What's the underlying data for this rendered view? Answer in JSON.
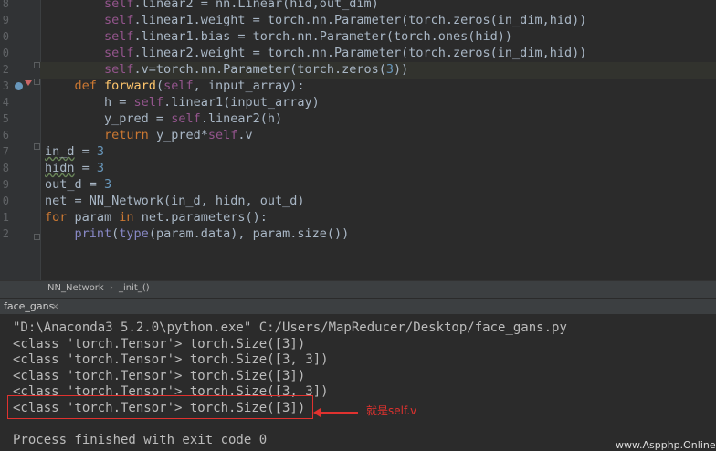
{
  "editor": {
    "line_numbers": [
      "8",
      "9",
      "0",
      "0",
      "2",
      "3",
      "4",
      "5",
      "6",
      "7",
      "8",
      "9",
      "0",
      "1",
      "2"
    ],
    "lines": [
      {
        "indent": "        ",
        "parts": [
          [
            "sf",
            "self"
          ],
          [
            "",
            "."
          ],
          [
            "",
            "linear2 = nn.Linear(hid,out_dim)"
          ]
        ]
      },
      {
        "indent": "        ",
        "parts": [
          [
            "sf",
            "self"
          ],
          [
            "",
            ".linear1.weight = torch.nn.Parameter(torch.zeros(in_dim,hid))"
          ]
        ]
      },
      {
        "indent": "        ",
        "parts": [
          [
            "sf",
            "self"
          ],
          [
            "",
            ".linear1.bias = torch.nn.Parameter(torch.ones(hid))"
          ]
        ]
      },
      {
        "indent": "        ",
        "parts": [
          [
            "sf",
            "self"
          ],
          [
            "",
            ".linear2.weight = torch.nn.Parameter(torch.zeros(in_dim,hid))"
          ]
        ]
      },
      {
        "indent": "        ",
        "parts": [
          [
            "sf",
            "self"
          ],
          [
            "",
            ".v=torch.nn.Parameter(torch.zeros("
          ],
          [
            "num",
            "3"
          ],
          [
            "",
            "))"
          ]
        ]
      },
      {
        "indent": "    ",
        "parts": [
          [
            "kw",
            "def "
          ],
          [
            "fn",
            "forward"
          ],
          [
            "",
            "("
          ],
          [
            "sf",
            "self"
          ],
          [
            "",
            ", input_array):"
          ]
        ]
      },
      {
        "indent": "        ",
        "parts": [
          [
            "",
            "h = "
          ],
          [
            "sf",
            "self"
          ],
          [
            "",
            ".linear1(input_array)"
          ]
        ]
      },
      {
        "indent": "        ",
        "parts": [
          [
            "",
            "y_pred = "
          ],
          [
            "sf",
            "self"
          ],
          [
            "",
            ".linear2(h)"
          ]
        ]
      },
      {
        "indent": "        ",
        "parts": [
          [
            "kw",
            "return "
          ],
          [
            "",
            "y_pred*"
          ],
          [
            "sf",
            "self"
          ],
          [
            "",
            ".v"
          ]
        ]
      },
      {
        "indent": "",
        "parts": [
          [
            "und",
            "in_d"
          ],
          [
            "",
            " = "
          ],
          [
            "num",
            "3"
          ]
        ]
      },
      {
        "indent": "",
        "parts": [
          [
            "und",
            "hidn"
          ],
          [
            "",
            " = "
          ],
          [
            "num",
            "3"
          ]
        ]
      },
      {
        "indent": "",
        "parts": [
          [
            "",
            "out_d = "
          ],
          [
            "num",
            "3"
          ]
        ]
      },
      {
        "indent": "",
        "parts": [
          [
            "",
            "net = NN_Network(in_d, hidn, out_d)"
          ]
        ]
      },
      {
        "indent": "",
        "parts": [
          [
            "kw",
            "for "
          ],
          [
            "",
            "param "
          ],
          [
            "kw",
            "in "
          ],
          [
            "",
            "net.parameters():"
          ]
        ]
      },
      {
        "indent": "    ",
        "parts": [
          [
            "bi",
            "print"
          ],
          [
            "",
            "("
          ],
          [
            "bi",
            "type"
          ],
          [
            "",
            "(param.data), param.size())"
          ]
        ]
      }
    ]
  },
  "breadcrumb": {
    "class": "NN_Network",
    "sep": "›",
    "method": "_init_()"
  },
  "run_tab": {
    "label": "face_gans",
    "close": "×"
  },
  "console": {
    "lines": [
      "\"D:\\Anaconda3 5.2.0\\python.exe\" C:/Users/MapReducer/Desktop/face_gans.py",
      "<class 'torch.Tensor'> torch.Size([3])",
      "<class 'torch.Tensor'> torch.Size([3, 3])",
      "<class 'torch.Tensor'> torch.Size([3])",
      "<class 'torch.Tensor'> torch.Size([3, 3])",
      "<class 'torch.Tensor'> torch.Size([3])",
      "",
      "Process finished with exit code 0"
    ]
  },
  "annotation": {
    "text": "就是self.v",
    "color": "#e0322f"
  },
  "watermark": "www.Aspphp.Online",
  "colors": {
    "background": "#2b2b2b",
    "keyword": "#cc7832",
    "self": "#94558d",
    "number": "#6897bb",
    "function": "#ffc66d",
    "builtin": "#8888c6"
  }
}
